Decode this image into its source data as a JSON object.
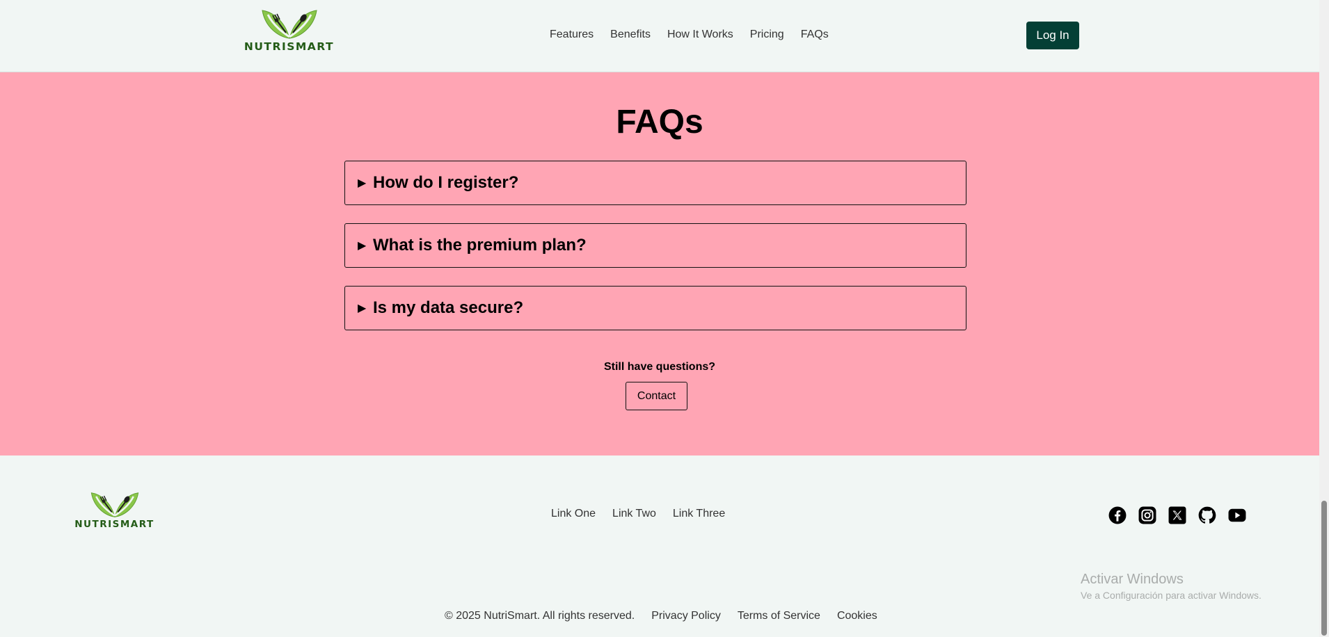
{
  "brand": {
    "name": "NUTRISMART",
    "colors": {
      "leaf_light": "#8ac64a",
      "leaf_dark": "#245c17",
      "primary": "#043f35",
      "section_bg": "#ffa5b4",
      "page_bg": "#f1f6f4"
    }
  },
  "header": {
    "nav": [
      "Features",
      "Benefits",
      "How It Works",
      "Pricing",
      "FAQs"
    ],
    "login_label": "Log In"
  },
  "faq": {
    "title": "FAQs",
    "items": [
      {
        "question": "How do I register?",
        "icon": "triangle-right-icon"
      },
      {
        "question": "What is the premium plan?",
        "icon": "triangle-right-icon"
      },
      {
        "question": "Is my data secure?",
        "icon": "triangle-right-icon"
      }
    ],
    "still_text": "Still have questions?",
    "contact_label": "Contact"
  },
  "footer": {
    "links": [
      "Link One",
      "Link Two",
      "Link Three"
    ],
    "socials": [
      "facebook-icon",
      "instagram-icon",
      "x-icon",
      "github-icon",
      "youtube-icon"
    ],
    "copyright": "© 2025 NutriSmart. All rights reserved.",
    "legal": [
      "Privacy Policy",
      "Terms of Service",
      "Cookies"
    ]
  },
  "watermark": {
    "line1": "Activar Windows",
    "line2": "Ve a Configuración para activar Windows."
  }
}
